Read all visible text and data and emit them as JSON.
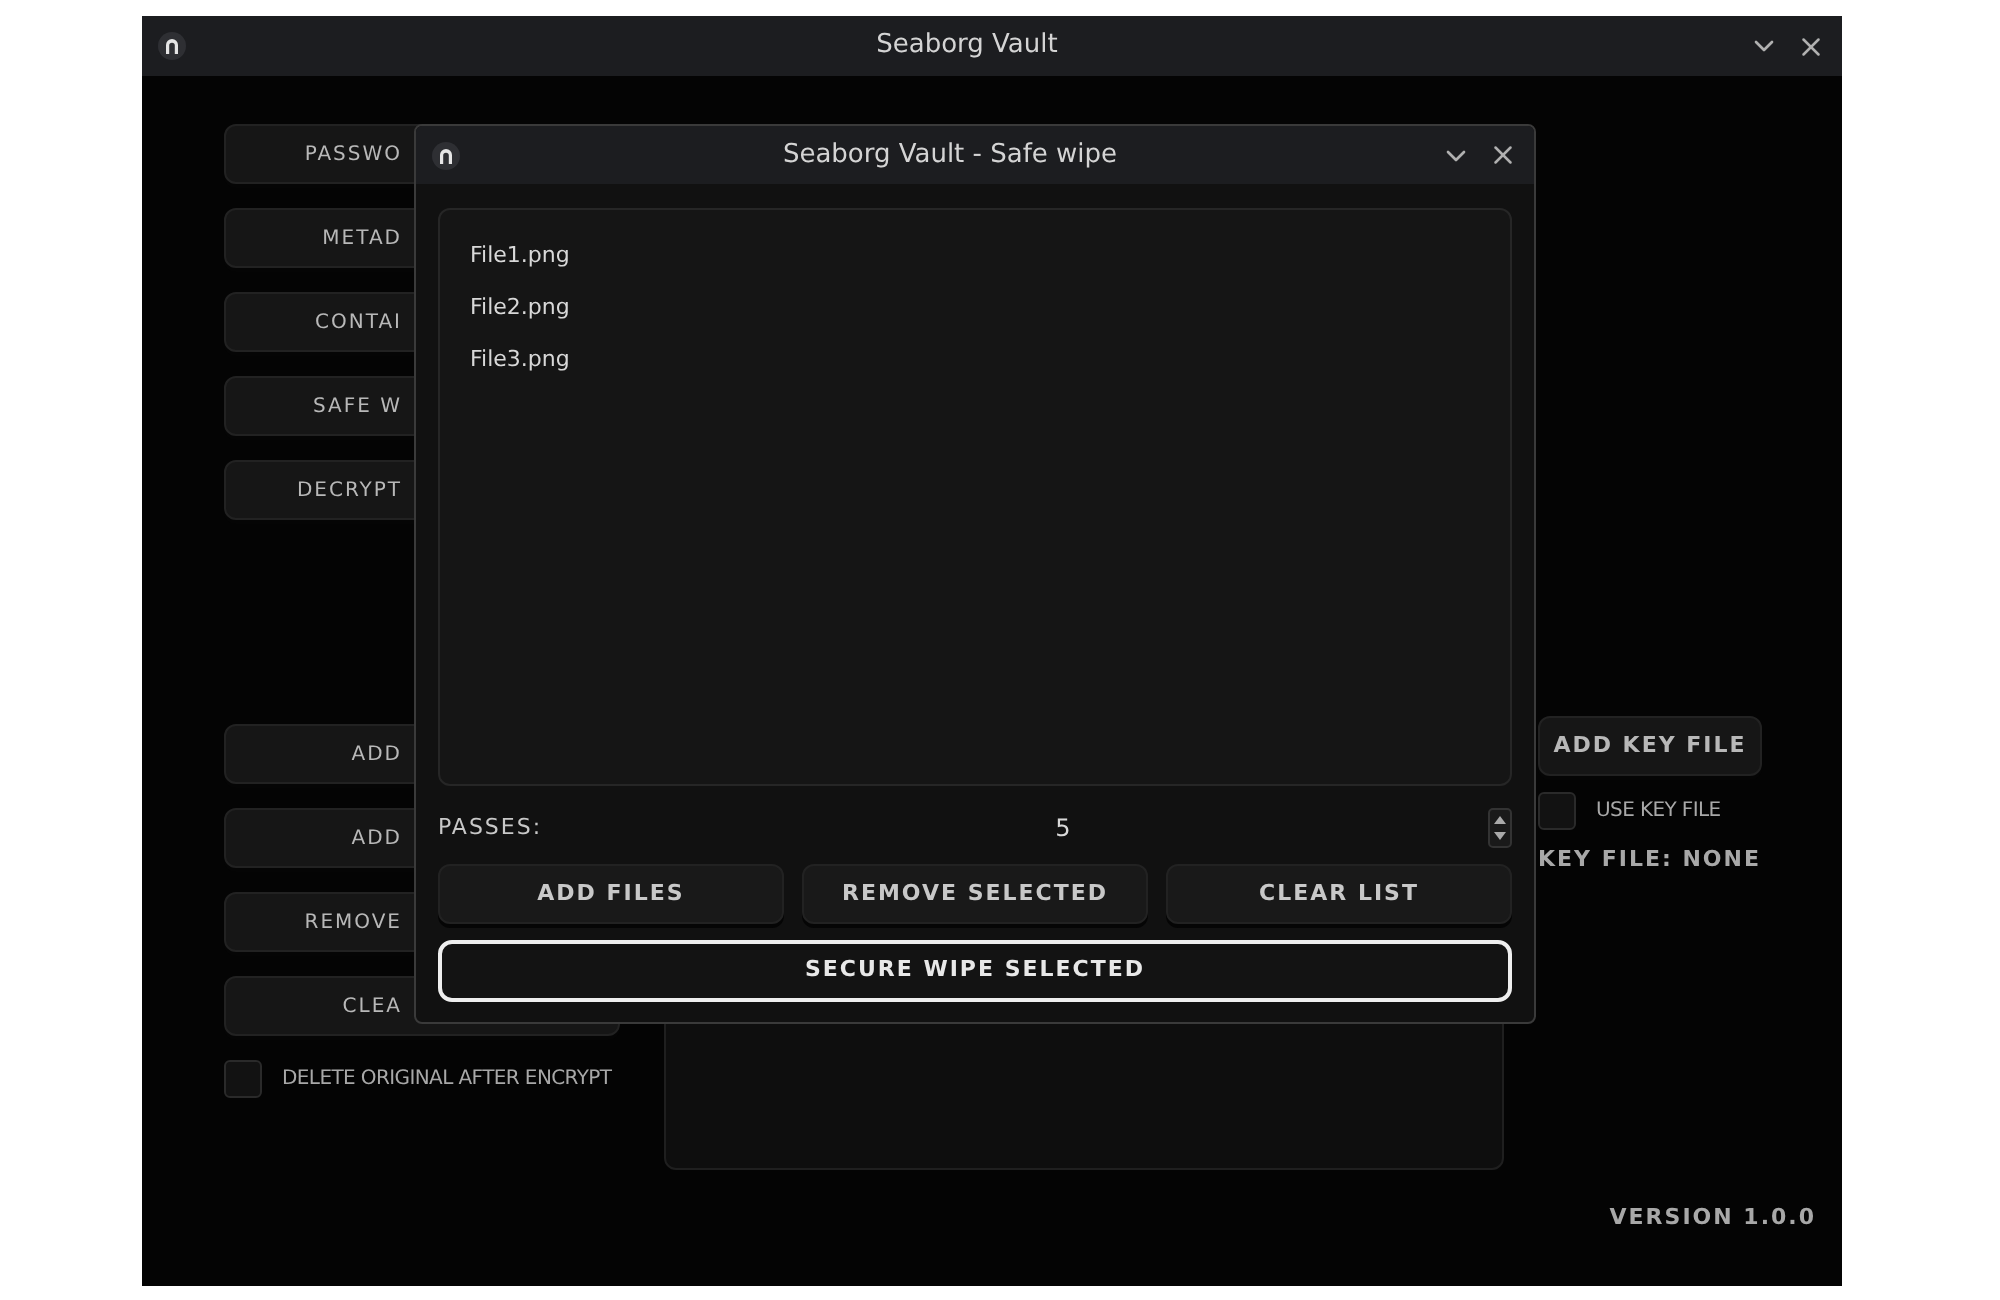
{
  "main_window": {
    "title": "Seaborg Vault",
    "sidebar_top": [
      {
        "label": "PASSWO"
      },
      {
        "label": "METAD"
      },
      {
        "label": "CONTAI"
      },
      {
        "label": "SAFE W"
      },
      {
        "label": "DECRYPT"
      }
    ],
    "sidebar_bottom": [
      {
        "label": "ADD"
      },
      {
        "label": "ADD"
      },
      {
        "label": "REMOVE"
      },
      {
        "label": "CLEA"
      }
    ],
    "delete_original": {
      "label": "DELETE ORIGINAL AFTER ENCRYPT",
      "checked": false
    },
    "add_key_file": "ADD KEY FILE",
    "use_key_file": {
      "label": "USE KEY FILE",
      "checked": false
    },
    "key_file_status": "KEY FILE: NONE",
    "version": "VERSION 1.0.0"
  },
  "dialog": {
    "title": "Seaborg Vault - Safe wipe",
    "files": [
      {
        "name": "File1.png",
        "selected": false
      },
      {
        "name": "File2.png",
        "selected": false
      },
      {
        "name": "File3.png",
        "selected": false
      }
    ],
    "passes": {
      "label": "PASSES:",
      "value": "5"
    },
    "buttons": [
      "ADD FILES",
      "REMOVE SELECTED",
      "CLEAR LIST"
    ],
    "primary_button": "SECURE WIPE SELECTED"
  }
}
